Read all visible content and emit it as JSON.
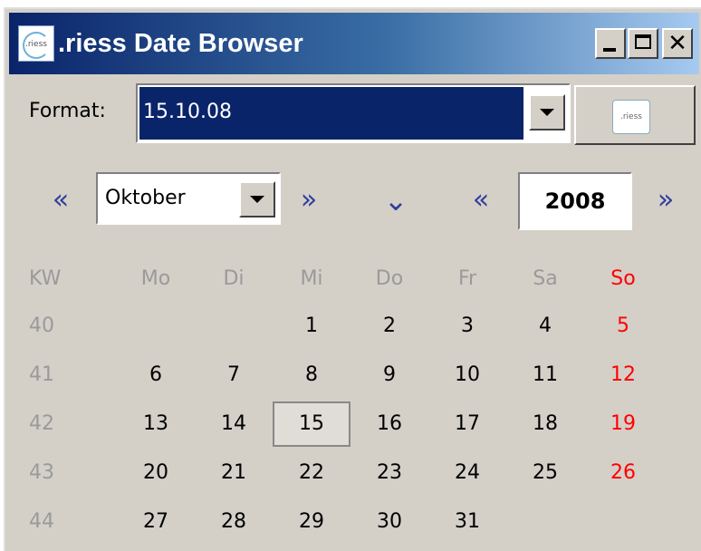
{
  "window": {
    "title": ".riess Date Browser",
    "icon": "riess-logo-icon",
    "controls": [
      "minimize",
      "maximize",
      "close"
    ],
    "close_glyph": "✕"
  },
  "format": {
    "label": "Format:",
    "value": "15.10.08"
  },
  "navigator": {
    "month": "Oktober",
    "year": "2008",
    "prev_icon": "«",
    "next_icon": "»",
    "expand_icon": "⌄"
  },
  "calendar": {
    "headers": [
      "KW",
      "Mo",
      "Di",
      "Mi",
      "Do",
      "Fr",
      "Sa",
      "So"
    ],
    "weeks": [
      {
        "kw": "40",
        "days": [
          "",
          "",
          "1",
          "2",
          "3",
          "4",
          "5"
        ]
      },
      {
        "kw": "41",
        "days": [
          "6",
          "7",
          "8",
          "9",
          "10",
          "11",
          "12"
        ]
      },
      {
        "kw": "42",
        "days": [
          "13",
          "14",
          "15",
          "16",
          "17",
          "18",
          "19"
        ]
      },
      {
        "kw": "43",
        "days": [
          "20",
          "21",
          "22",
          "23",
          "24",
          "25",
          "26"
        ]
      },
      {
        "kw": "44",
        "days": [
          "27",
          "28",
          "29",
          "30",
          "31",
          "",
          ""
        ]
      }
    ],
    "selected_day": "15",
    "colors": {
      "sunday": "#ff0000",
      "muted": "#9a9a9a",
      "selection": "#0a246a"
    }
  }
}
